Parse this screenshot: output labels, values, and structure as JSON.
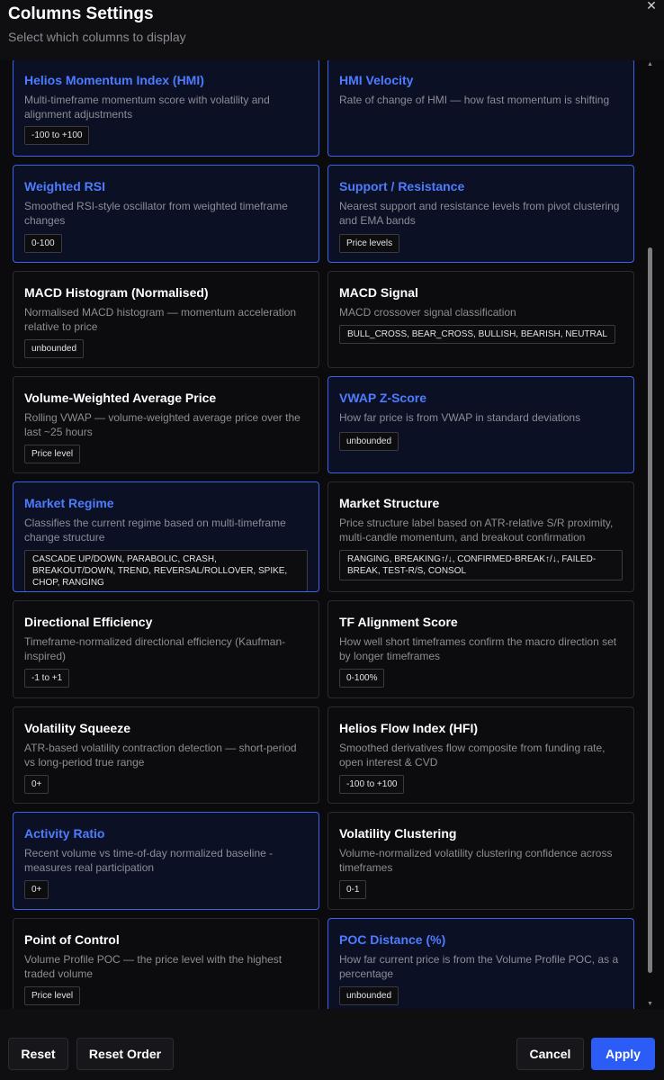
{
  "dialog": {
    "title": "Columns Settings",
    "subtitle": "Select which columns to display",
    "close_glyph": "✕"
  },
  "columns": [
    {
      "title": "Helios Momentum Index (HMI)",
      "description": "Multi-timeframe momentum score with volatility and alignment adjustments",
      "badge": "-100 to +100",
      "selected": true
    },
    {
      "title": "HMI Velocity",
      "description": "Rate of change of HMI — how fast momentum is shifting",
      "badge": "",
      "selected": true
    },
    {
      "title": "Weighted RSI",
      "description": "Smoothed RSI-style oscillator from weighted timeframe changes",
      "badge": "0-100",
      "selected": true
    },
    {
      "title": "Support / Resistance",
      "description": "Nearest support and resistance levels from pivot clustering and EMA bands",
      "badge": "Price levels",
      "selected": true
    },
    {
      "title": "MACD Histogram (Normalised)",
      "description": "Normalised MACD histogram — momentum acceleration relative to price",
      "badge": "unbounded",
      "selected": false
    },
    {
      "title": "MACD Signal",
      "description": "MACD crossover signal classification",
      "badge": "BULL_CROSS, BEAR_CROSS, BULLISH, BEARISH, NEUTRAL",
      "selected": false
    },
    {
      "title": "Volume-Weighted Average Price",
      "description": "Rolling VWAP — volume-weighted average price over the last ~25 hours",
      "badge": "Price level",
      "selected": false
    },
    {
      "title": "VWAP Z-Score",
      "description": "How far price is from VWAP in standard deviations",
      "badge": "unbounded",
      "selected": true
    },
    {
      "title": "Market Regime",
      "description": "Classifies the current regime based on multi-timeframe change structure",
      "badge": "CASCADE UP/DOWN, PARABOLIC, CRASH, BREAKOUT/DOWN, TREND, REVERSAL/ROLLOVER, SPIKE, CHOP, RANGING",
      "selected": true
    },
    {
      "title": "Market Structure",
      "description": "Price structure label based on ATR-relative S/R proximity, multi-candle momentum, and breakout confirmation",
      "badge": "RANGING, BREAKING↑/↓, CONFIRMED-BREAK↑/↓, FAILED-BREAK, TEST-R/S, CONSOL",
      "selected": false
    },
    {
      "title": "Directional Efficiency",
      "description": "Timeframe-normalized directional efficiency (Kaufman-inspired)",
      "badge": "-1 to +1",
      "selected": false
    },
    {
      "title": "TF Alignment Score",
      "description": "How well short timeframes confirm the macro direction set by longer timeframes",
      "badge": "0-100%",
      "selected": false
    },
    {
      "title": "Volatility Squeeze",
      "description": "ATR-based volatility contraction detection — short-period vs long-period true range",
      "badge": "0+",
      "selected": false
    },
    {
      "title": "Helios Flow Index (HFI)",
      "description": "Smoothed derivatives flow composite from funding rate, open interest & CVD",
      "badge": "-100 to +100",
      "selected": false
    },
    {
      "title": "Activity Ratio",
      "description": "Recent volume vs time-of-day normalized baseline - measures real participation",
      "badge": "0+",
      "selected": true
    },
    {
      "title": "Volatility Clustering",
      "description": "Volume-normalized volatility clustering confidence across timeframes",
      "badge": "0-1",
      "selected": false
    },
    {
      "title": "Point of Control",
      "description": "Volume Profile POC — the price level with the highest traded volume",
      "badge": "Price level",
      "selected": false
    },
    {
      "title": "POC Distance (%)",
      "description": "How far current price is from the Volume Profile POC, as a percentage",
      "badge": "unbounded",
      "selected": true
    }
  ],
  "footer": {
    "reset_label": "Reset",
    "reset_order_label": "Reset Order",
    "cancel_label": "Cancel",
    "apply_label": "Apply"
  },
  "colors": {
    "accent": "#2b5cf5",
    "selected_title": "#4d7cff",
    "selected_border": "#3b63f0"
  }
}
